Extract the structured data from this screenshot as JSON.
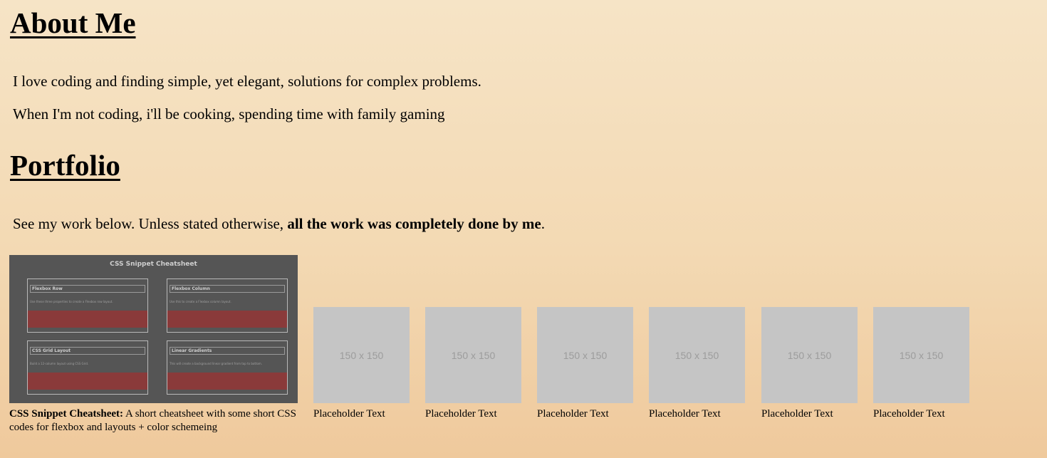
{
  "about": {
    "heading": "About Me",
    "paragraph1": "I love coding and finding simple, yet elegant, solutions for complex problems.",
    "paragraph2": "When I'm not coding, i'll be cooking, spending time with family gaming"
  },
  "portfolio": {
    "heading": "Portfolio",
    "intro_prefix": "See my work below. Unless stated otherwise, ",
    "intro_bold": "all the work was completely done by me",
    "intro_suffix": ".",
    "featured": {
      "caption_title": "CSS Snippet Cheatsheet:",
      "caption_text": " A short cheatsheet with some short CSS codes for flexbox and layouts + color schemeing",
      "image": {
        "title": "CSS Snippet Cheatsheet",
        "boxes": [
          {
            "title": "Flexbox Row",
            "desc": "Use these three properties to create a Flexbox row layout."
          },
          {
            "title": "Flexbox Column",
            "desc": "Use this to create a Flexbox column layout."
          },
          {
            "title": "CSS Grid Layout",
            "desc": "Build a 12-column layout using CSS Grid."
          },
          {
            "title": "Linear Gradients",
            "desc": "This will create a background linear gradient from top to bottom."
          }
        ]
      }
    },
    "placeholders": [
      {
        "image_text": "150 x 150",
        "caption": "Placeholder Text"
      },
      {
        "image_text": "150 x 150",
        "caption": "Placeholder Text"
      },
      {
        "image_text": "150 x 150",
        "caption": "Placeholder Text"
      },
      {
        "image_text": "150 x 150",
        "caption": "Placeholder Text"
      },
      {
        "image_text": "150 x 150",
        "caption": "Placeholder Text"
      },
      {
        "image_text": "150 x 150",
        "caption": "Placeholder Text"
      }
    ]
  }
}
